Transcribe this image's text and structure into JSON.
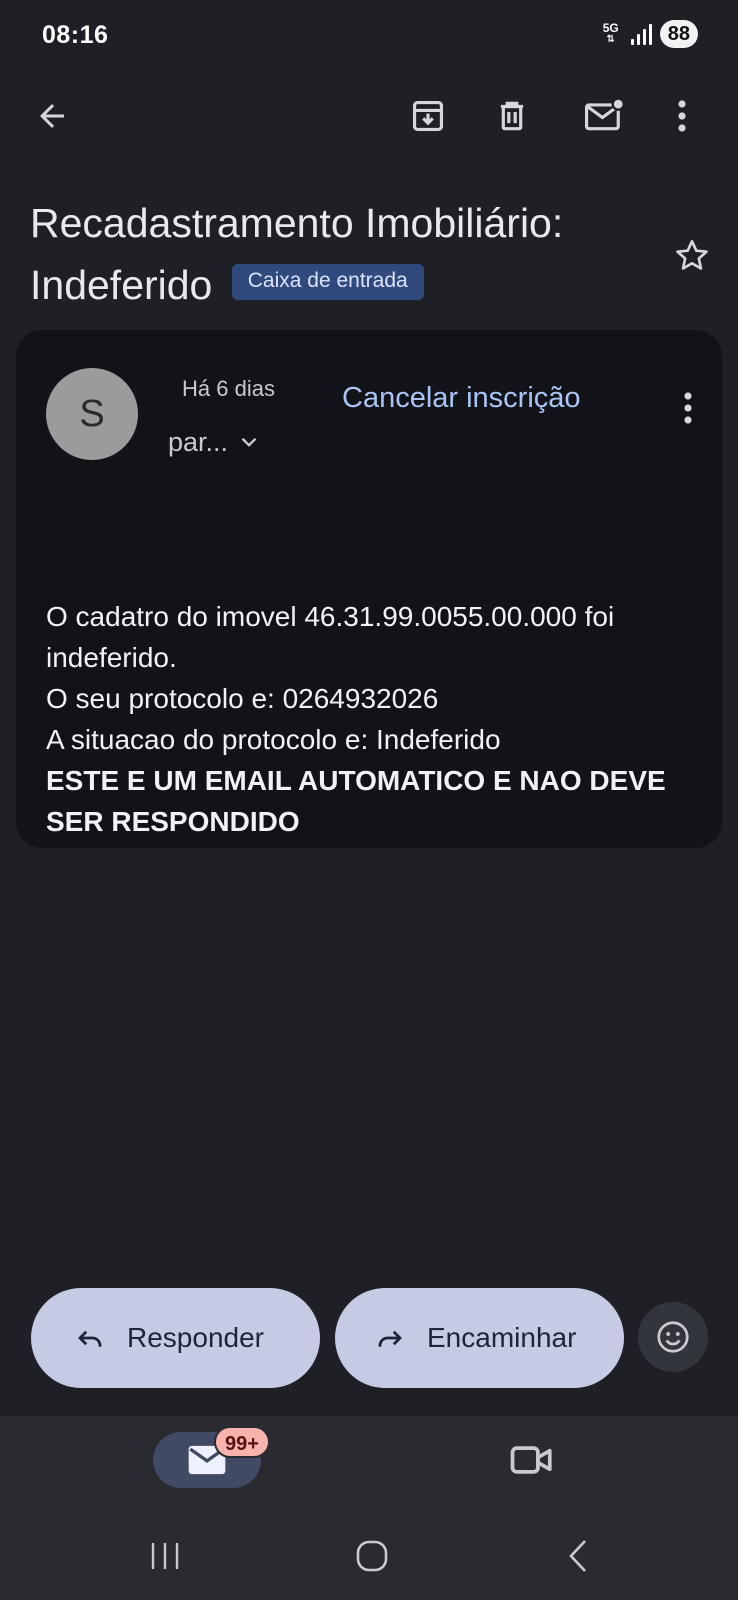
{
  "status_bar": {
    "time": "08:16",
    "network": "5G",
    "battery": "88"
  },
  "toolbar": {
    "back": "arrow-left-icon",
    "archive": "archive-icon",
    "delete": "trash-icon",
    "mark_unread": "mail-unread-icon",
    "more": "more-vert-icon"
  },
  "email": {
    "subject": "Recadastramento Imobiliário: Indeferido",
    "label": "Caixa de entrada",
    "sender_initial": "S",
    "date": "Há 6 dias",
    "recipients": "par...",
    "unsubscribe": "Cancelar inscrição",
    "body": {
      "line1": "O cadatro do imovel 46.31.99.0055.00.000 foi indeferido.",
      "line2": "O seu protocolo e: 0264932026",
      "line3": "A situacao do protocolo e: Indeferido",
      "line4": "ESTE E UM EMAIL AUTOMATICO E NAO DEVE SER RESPONDIDO"
    }
  },
  "actions": {
    "reply": "Responder",
    "forward": "Encaminhar"
  },
  "bottom_nav": {
    "mail_badge": "99+"
  },
  "colors": {
    "background": "#1f2026",
    "card": "#111318",
    "accent_link": "#a9c4f5",
    "label_chip": "#314a7e",
    "pill": "#c5cbe3",
    "badge": "#f8b4ac"
  }
}
